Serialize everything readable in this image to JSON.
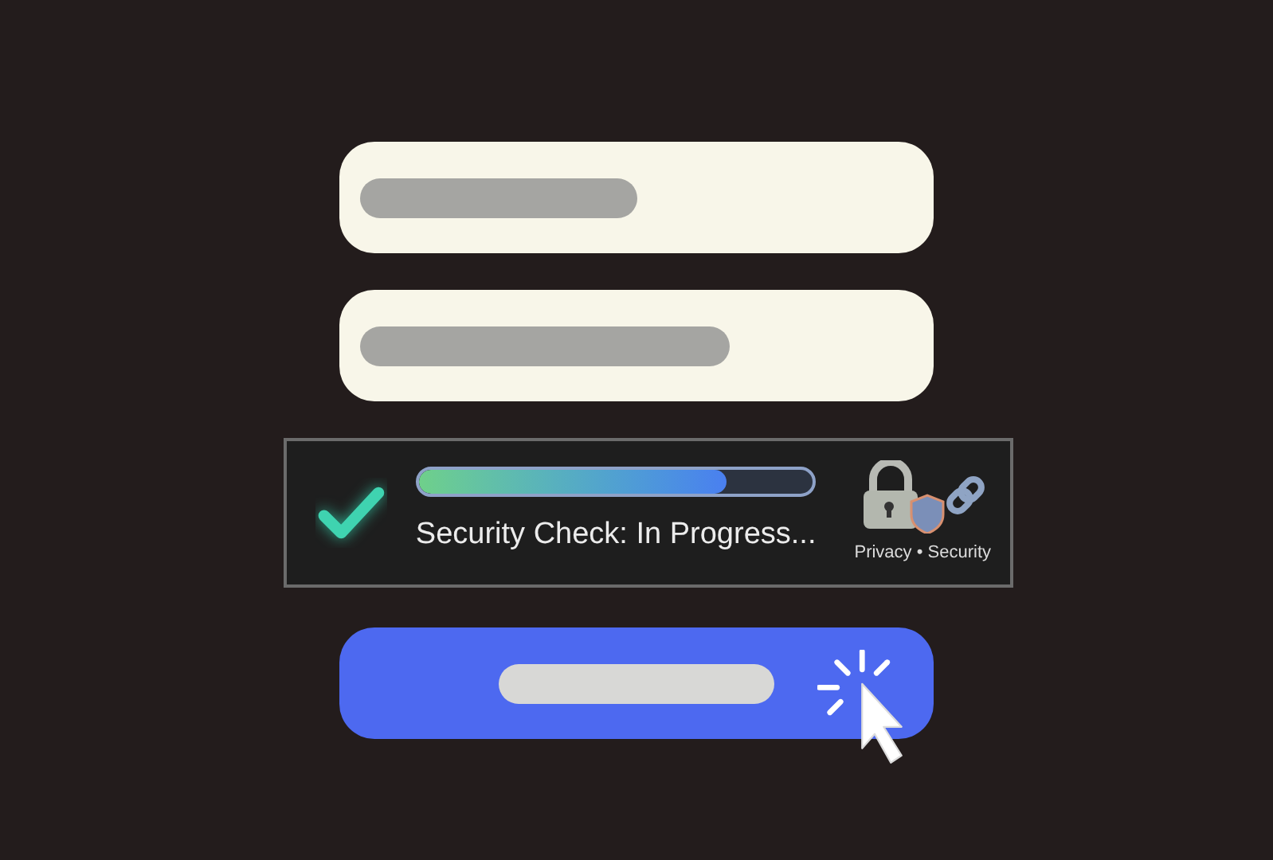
{
  "fields": [
    {
      "kind": "short"
    },
    {
      "kind": "long"
    }
  ],
  "security_panel": {
    "checked": true,
    "level": 0.78,
    "label": "Security Check: In Progress...",
    "caption": "Privacy • Security"
  },
  "button": {
    "kind": "skeleton-button"
  }
}
